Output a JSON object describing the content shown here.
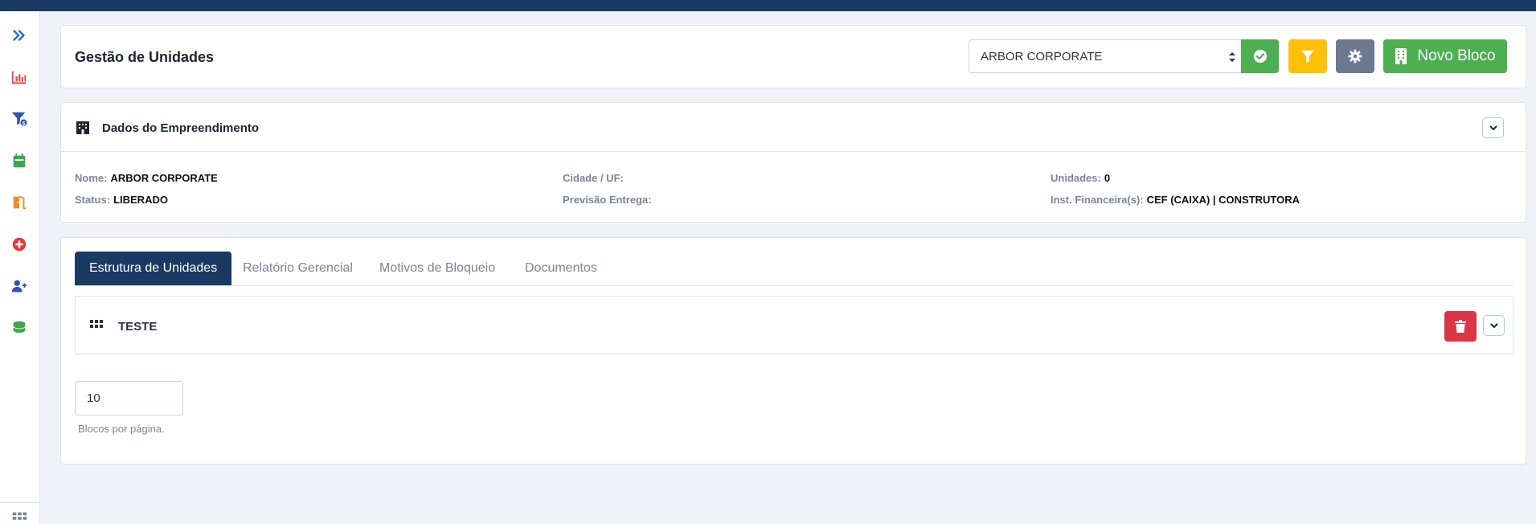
{
  "header": {
    "title": "Gestão de Unidades",
    "select_value": "ARBOR CORPORATE",
    "new_block_label": "Novo Bloco"
  },
  "sidebar": {
    "items": [
      {
        "icon": "double-chevron-right-icon",
        "color": "#1f6fd1"
      },
      {
        "icon": "bar-chart-icon",
        "color": "#e04848"
      },
      {
        "icon": "funnel-dollar-icon",
        "color": "#2f52b5"
      },
      {
        "icon": "calendar-icon",
        "color": "#3aa84a"
      },
      {
        "icon": "door-open-icon",
        "color": "#f08a24"
      },
      {
        "icon": "plus-circle-icon",
        "color": "#e53935"
      },
      {
        "icon": "user-plus-icon",
        "color": "#2f52b5"
      },
      {
        "icon": "coins-stack-icon",
        "color": "#3aa84a"
      },
      {
        "icon": "grid-icon",
        "color": "#7a8499"
      }
    ]
  },
  "dados": {
    "title": "Dados do Empreendimento",
    "nome_label": "Nome:",
    "nome_value": "ARBOR CORPORATE",
    "status_label": "Status:",
    "status_value": "LIBERADO",
    "cidade_label": "Cidade / UF:",
    "cidade_value": "",
    "previsao_label": "Previsão Entrega:",
    "previsao_value": "",
    "unidades_label": "Unidades:",
    "unidades_value": "0",
    "inst_label": "Inst. Financeira(s):",
    "inst_value": "CEF (CAIXA) | CONSTRUTORA"
  },
  "tabs": [
    {
      "label": "Estrutura de Unidades",
      "active": true
    },
    {
      "label": "Relatório Gerencial",
      "active": false
    },
    {
      "label": "Motivos de Bloqueio",
      "active": false
    },
    {
      "label": "Documentos",
      "active": false
    }
  ],
  "blocks": [
    {
      "name": "TESTE"
    }
  ],
  "pagination": {
    "per_page_value": "10",
    "per_page_help": "Blocos por página."
  },
  "colors": {
    "primary_navy": "#1b3a63",
    "success": "#4caf50",
    "warning": "#ffc107",
    "secondary": "#6c7a91",
    "danger": "#dc3545"
  }
}
